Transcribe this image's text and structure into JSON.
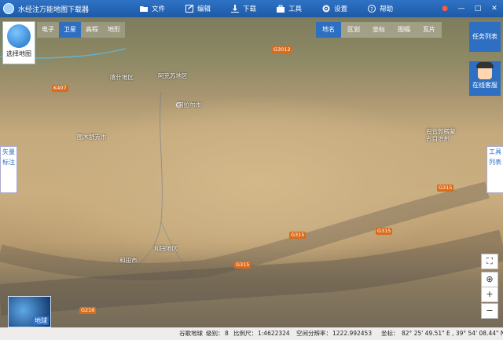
{
  "app": {
    "title": "水经注万能地图下载器"
  },
  "menu": [
    {
      "label": "文件",
      "icon": "folder-icon"
    },
    {
      "label": "编辑",
      "icon": "edit-icon"
    },
    {
      "label": "下载",
      "icon": "download-icon"
    },
    {
      "label": "工具",
      "icon": "toolbox-icon"
    },
    {
      "label": "设置",
      "icon": "gear-icon"
    },
    {
      "label": "帮助",
      "icon": "help-icon"
    }
  ],
  "map_select": {
    "label": "选择地图"
  },
  "map_type_tabs": [
    "电子",
    "卫星",
    "高程",
    "地形"
  ],
  "active_map_type": "卫星",
  "tool_tabs": [
    "地名",
    "区划",
    "坐标",
    "图幅",
    "瓦片"
  ],
  "task_list": {
    "label": "任务列表"
  },
  "service": {
    "label": "在线客服"
  },
  "side_tabs": {
    "vector": "矢量标注",
    "tools": "工具列表"
  },
  "minimap": {
    "label": "地球"
  },
  "map_labels": [
    {
      "text": "阿克苏地区"
    },
    {
      "text": "阿拉尔市"
    },
    {
      "text": "喀什地区"
    },
    {
      "text": "图木舒克市"
    },
    {
      "text": "和田地区"
    },
    {
      "text": "和田市"
    },
    {
      "text": "巴音郭楞蒙古自治州"
    }
  ],
  "roads": [
    "G3012",
    "K407",
    "G315",
    "G315",
    "G315",
    "G315",
    "G216"
  ],
  "status": {
    "source": "谷歌地球",
    "level_label": "级别：",
    "level": "8",
    "scale_label": "比例尺：",
    "scale": "1:4622324",
    "resolution_label": "空间分辨率：",
    "resolution": "1222.992453",
    "coord_label": "坐标：",
    "coords": "82° 25' 49.51\" E , 39° 54' 08.44\" N"
  },
  "colors": {
    "accent": "#2e6fc2",
    "titlebar": "#1d5aa8",
    "road": "#d96b1b"
  }
}
